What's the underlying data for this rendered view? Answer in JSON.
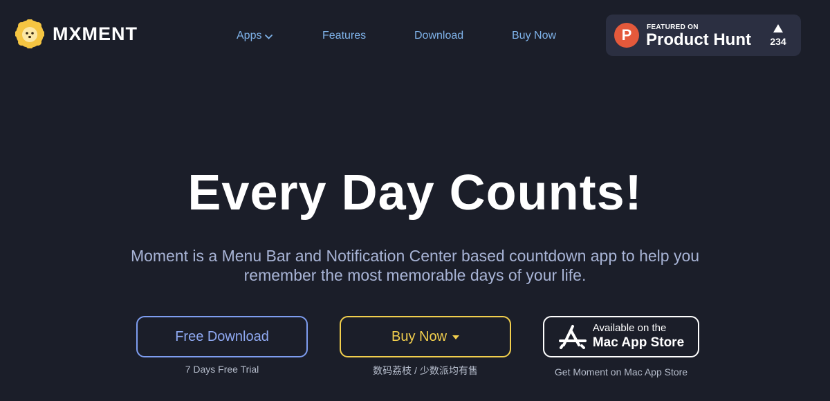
{
  "logo": {
    "text": "MXMENT",
    "icon": "sun-face-icon",
    "color": "#f5c542"
  },
  "nav": {
    "items": [
      {
        "label": "Apps",
        "has_dropdown": true
      },
      {
        "label": "Features"
      },
      {
        "label": "Download"
      },
      {
        "label": "Buy Now"
      }
    ],
    "color": "#7fb3ea"
  },
  "product_hunt": {
    "featured_label": "FEATURED ON",
    "name": "Product Hunt",
    "logo_letter": "P",
    "votes": "234",
    "icon": "upvote-triangle-icon",
    "brand_color": "#e4593b"
  },
  "hero": {
    "title": "Every Day Counts!",
    "subtitle": "Moment is a Menu Bar and Notification Center based countdown app to help you remember the most memorable days of your life."
  },
  "cta": {
    "free_download": {
      "label": "Free Download",
      "caption": "7 Days Free Trial",
      "color": "#7e9df0"
    },
    "buy_now": {
      "label": "Buy Now",
      "caption": "数码荔枝 / 少数派均有售",
      "color": "#f2cf4d"
    },
    "mac_app_store": {
      "line1": "Available on the",
      "line2": "Mac App Store",
      "caption": "Get Moment on Mac App Store",
      "icon": "app-store-icon"
    }
  },
  "colors": {
    "background": "#1b1e29",
    "subtitle": "#a8b4d6"
  }
}
